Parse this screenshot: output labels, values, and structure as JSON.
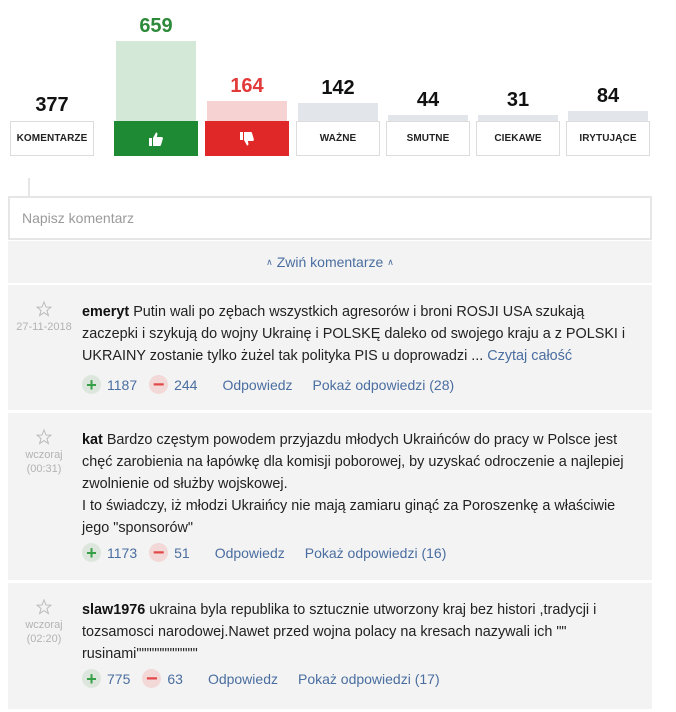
{
  "reactions": {
    "items": [
      {
        "key": "komentarze",
        "label": "KOMENTARZE",
        "count": "377",
        "fill": 0
      },
      {
        "key": "like",
        "label": "",
        "icon": "thumbs-up-icon",
        "count": "659",
        "fill": 1.0
      },
      {
        "key": "dislike",
        "label": "",
        "icon": "thumbs-down-icon",
        "count": "164",
        "fill": 0.25
      },
      {
        "key": "wazne",
        "label": "WAŻNE",
        "count": "142",
        "fill": 0.22
      },
      {
        "key": "smutne",
        "label": "SMUTNE",
        "count": "44",
        "fill": 0.07
      },
      {
        "key": "ciekawe",
        "label": "CIEKAWE",
        "count": "31",
        "fill": 0.05
      },
      {
        "key": "irytujace",
        "label": "IRYTUJĄCE",
        "count": "84",
        "fill": 0.13
      }
    ],
    "colors": {
      "like": "#1e8a33",
      "like_bar": "#d3e8d6",
      "dislike": "#e02828",
      "dislike_bar": "#f6d2d2",
      "neutral_bar": "#e2e6ea"
    }
  },
  "comment_input": {
    "placeholder": "Napisz komentarz"
  },
  "collapse": {
    "label": "Zwiń komentarze"
  },
  "comments": [
    {
      "author": "emeryt",
      "date": "27-11-2018",
      "time": "",
      "text": "Putin wali po zębach wszystkich agresorów i broni ROSJI USA szukają zaczepki i szykują do wojny Ukrainę i POLSKĘ daleko od swojego kraju a z POLSKI i UKRAINY zostanie tylko żużel tak polityka PIS u doprowadzi ... ",
      "read_more": "Czytaj całość",
      "up": "1187",
      "down": "244",
      "reply": "Odpowiedz",
      "show_replies": "Pokaż odpowiedzi (28)"
    },
    {
      "author": "kat",
      "date": "wczoraj",
      "time": "(00:31)",
      "text": "Bardzo częstym powodem przyjazdu młodych Ukraińców do pracy w Polsce jest chęć zarobienia na łapówkę dla komisji poborowej, by uzyskać odroczenie a najlepiej zwolnienie od służby wojskowej.",
      "text2": "I to świadczy, iż młodzi Ukraińcy nie mają zamiaru ginąć za Poroszenkę a właściwie jego \"sponsorów\"",
      "up": "1173",
      "down": "51",
      "reply": "Odpowiedz",
      "show_replies": "Pokaż odpowiedzi (16)"
    },
    {
      "author": "slaw1976",
      "date": "wczoraj",
      "time": "(02:20)",
      "text": "ukraina byla republika to sztucznie utworzony kraj bez histori ,tradycji i tozsamosci narodowej.Nawet przed wojna polacy na kresach nazywali ich \"\" rusinami\"\"\"\"\"\"\"\"\"\"\"\"",
      "up": "775",
      "down": "63",
      "reply": "Odpowiedz",
      "show_replies": "Pokaż odpowiedzi (17)"
    }
  ]
}
